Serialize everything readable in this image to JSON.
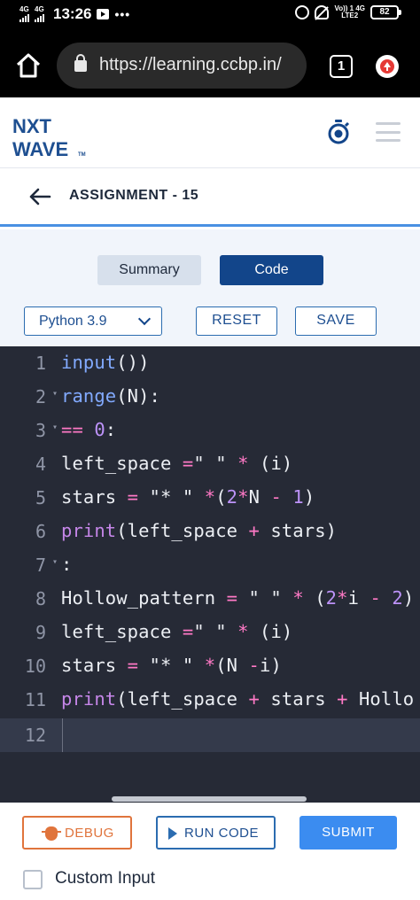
{
  "status_bar": {
    "net1": "4G",
    "net2": "4G",
    "time": "13:26",
    "more": "•••",
    "volte_top": "Vo)) 1 4G",
    "volte_bottom": "LTE2",
    "battery": "82"
  },
  "browser": {
    "url": "https://learning.ccbp.in/",
    "tab_count": "1"
  },
  "header": {
    "logo_line1": "NXT",
    "logo_line2": "WAVE",
    "logo_tm": "TM"
  },
  "assignment": {
    "title": "ASSIGNMENT - 15"
  },
  "panel": {
    "tab_summary": "Summary",
    "tab_code": "Code",
    "language": "Python 3.9",
    "reset_label": "RESET",
    "save_label": "SAVE"
  },
  "editor": {
    "lines": [
      {
        "num": "1",
        "fold": ""
      },
      {
        "num": "2",
        "fold": "▾"
      },
      {
        "num": "3",
        "fold": "▾"
      },
      {
        "num": "4",
        "fold": ""
      },
      {
        "num": "5",
        "fold": ""
      },
      {
        "num": "6",
        "fold": ""
      },
      {
        "num": "7",
        "fold": "▾"
      },
      {
        "num": "8",
        "fold": ""
      },
      {
        "num": "9",
        "fold": ""
      },
      {
        "num": "10",
        "fold": ""
      },
      {
        "num": "11",
        "fold": ""
      },
      {
        "num": "12",
        "fold": ""
      }
    ],
    "code": {
      "l1": [
        "input",
        "())"
      ],
      "l2": [
        " range",
        "(N):"
      ],
      "l3": [
        " ",
        "==",
        " ",
        "0",
        ":"
      ],
      "l4": [
        "left_space ",
        "=",
        "\" \" ",
        "*",
        " (i)"
      ],
      "l5": [
        "stars ",
        "=",
        " \"* \" ",
        "*",
        "(",
        "2",
        "*",
        "N ",
        "-",
        " ",
        "1",
        ")"
      ],
      "l6": [
        "print",
        "(left_space ",
        "+",
        " stars)"
      ],
      "l7": [
        ":"
      ],
      "l8": [
        "Hollow_pattern ",
        "=",
        " \" \" ",
        "*",
        " (",
        "2",
        "*",
        "i ",
        "-",
        " ",
        "2",
        ")"
      ],
      "l9": [
        "left_space ",
        "=",
        "\" \" ",
        "*",
        " (i)"
      ],
      "l10": [
        "stars ",
        "=",
        " \"* \" ",
        "*",
        "(N ",
        "-",
        "i)"
      ],
      "l11": [
        "print",
        "(left_space ",
        "+",
        " stars ",
        "+",
        " Hollo"
      ]
    }
  },
  "bottom": {
    "debug_label": "DEBUG",
    "run_label": "RUN CODE",
    "submit_label": "SUBMIT",
    "custom_input_label": "Custom Input"
  },
  "colors": {
    "brand_dark": "#12458a",
    "editor_bg": "#262a36",
    "debug_orange": "#e0743c",
    "submit_blue": "#3b8cf0"
  }
}
